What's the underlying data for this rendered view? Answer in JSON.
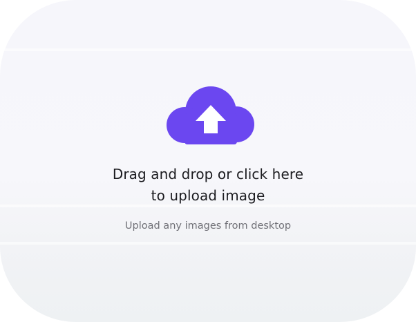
{
  "upload": {
    "title_line_1": "Drag and drop or click here",
    "title_line_2": "to upload image",
    "subtitle": "Upload any images from desktop",
    "icon": "cloud-upload-icon"
  },
  "colors": {
    "accent": "#6b47f0",
    "title_text": "#1b1b1f",
    "subtitle_text": "#6f6f76"
  }
}
